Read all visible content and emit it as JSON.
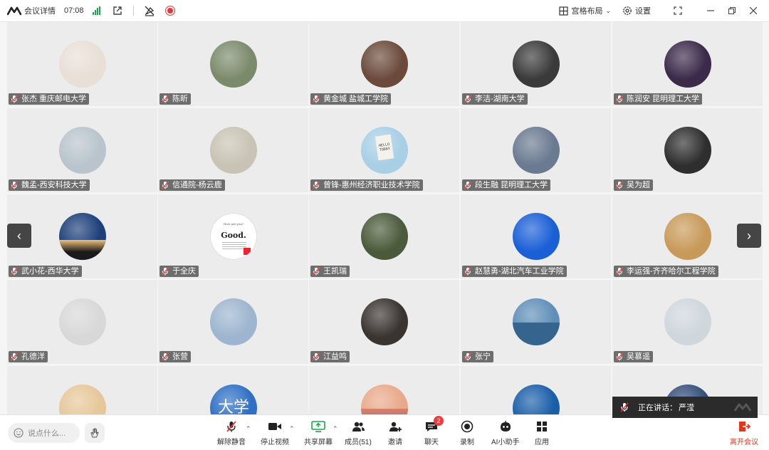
{
  "topbar": {
    "meeting_details": "会议详情",
    "time": "07:08",
    "layout_label": "宫格布局",
    "settings_label": "设置"
  },
  "participants": [
    {
      "name": "张杰 重庆邮电大学",
      "color": "#e8dfd6"
    },
    {
      "name": "陈昕",
      "color": "#7b8a6b"
    },
    {
      "name": "黄金城 盐城工学院",
      "color": "#6b4a3c"
    },
    {
      "name": "李洁-湖南大学",
      "color": "#3a3a3a"
    },
    {
      "name": "陈润安 昆明理工大学",
      "color": "#3b2a4a"
    },
    {
      "name": "魏孟-西安科技大学",
      "color": "#b9c4cc"
    },
    {
      "name": "信通院-杨云鹿",
      "color": "#c8c3b4"
    },
    {
      "name": "曾锋-惠州经济职业技术学院",
      "color": "#a8cfe6"
    },
    {
      "name": "段生融 昆明理工大学",
      "color": "#6a7a90"
    },
    {
      "name": "吴为超",
      "color": "#2e2e2e"
    },
    {
      "name": "武小花-西华大学",
      "color": "#1d3f7a"
    },
    {
      "name": "于全庆",
      "color": "#ffffff"
    },
    {
      "name": "王凯瑞",
      "color": "#4a5a3a"
    },
    {
      "name": "赵慧勇-湖北汽车工业学院",
      "color": "#1a5fd6"
    },
    {
      "name": "李运强-齐齐哈尔工程学院",
      "color": "#c89a5a"
    },
    {
      "name": "孔德洋",
      "color": "#d8d8d8"
    },
    {
      "name": "张营",
      "color": "#9db5cf"
    },
    {
      "name": "江益鸣",
      "color": "#3a3430"
    },
    {
      "name": "张宁",
      "color": "#5f8fb8"
    },
    {
      "name": "吴慕遥",
      "color": "#cfd6dc"
    },
    {
      "name": "",
      "color": "#e6c79a"
    },
    {
      "name": "",
      "color": "#2f6fc4"
    },
    {
      "name": "",
      "color": "#e8a98a"
    },
    {
      "name": "",
      "color": "#1b5ea8"
    },
    {
      "name": "",
      "color": "#35507a"
    }
  ],
  "avatar_text": {
    "hello_today": "HELLO TODAY",
    "good_header": "How are you?",
    "good": "Good.",
    "daxue": "大学"
  },
  "speaking": {
    "label": "正在讲话：",
    "name": "严滢"
  },
  "toolbar": {
    "chat_placeholder": "说点什么...",
    "unmute": "解除静音",
    "stop_video": "停止视频",
    "share_screen": "共享屏幕",
    "members": "成员(51)",
    "invite": "邀请",
    "chat": "聊天",
    "chat_badge": "2",
    "record": "录制",
    "ai_assistant": "AI小助手",
    "apps": "应用",
    "leave": "离开会议"
  },
  "colors": {
    "accent_green": "#19a84c",
    "record_red": "#e33333",
    "leave_red": "#e0361e",
    "badge_red": "#f03c3c"
  }
}
